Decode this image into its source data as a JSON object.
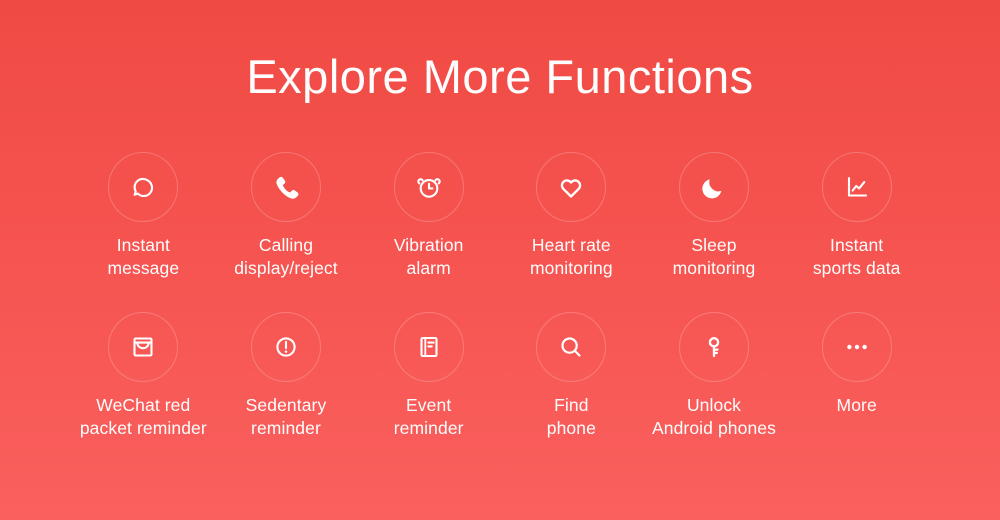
{
  "page": {
    "title": "Explore More Functions",
    "background_top_color": "#F04A44",
    "background_bottom_color": "#FA605E",
    "text_color": "#FFFFFF",
    "circle_stroke_color": "rgba(255,255,255,0.22)"
  },
  "features": {
    "row1": [
      {
        "icon": "chat-bubble-icon",
        "label": "Instant\nmessage"
      },
      {
        "icon": "phone-handset-icon",
        "label": "Calling\ndisplay/reject"
      },
      {
        "icon": "alarm-clock-icon",
        "label": "Vibration\nalarm"
      },
      {
        "icon": "heart-outline-icon",
        "label": "Heart rate\nmonitoring"
      },
      {
        "icon": "crescent-moon-icon",
        "label": "Sleep\nmonitoring"
      },
      {
        "icon": "line-chart-icon",
        "label": "Instant\nsports data"
      }
    ],
    "row2": [
      {
        "icon": "envelope-icon",
        "label": "WeChat red\npacket reminder"
      },
      {
        "icon": "exclamation-circle-icon",
        "label": "Sedentary\nreminder"
      },
      {
        "icon": "document-lines-icon",
        "label": "Event\nreminder"
      },
      {
        "icon": "magnifier-icon",
        "label": "Find\nphone"
      },
      {
        "icon": "key-icon",
        "label": "Unlock\nAndroid phones"
      },
      {
        "icon": "ellipsis-icon",
        "label": "More"
      }
    ]
  }
}
